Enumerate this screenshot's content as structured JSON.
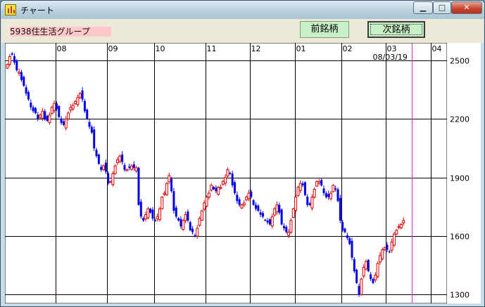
{
  "window": {
    "title": "チャート",
    "app_icon": "chart-app-icon",
    "controls": {
      "minimize": "minimize-icon",
      "maximize": "maximize-icon",
      "close": "close-icon"
    }
  },
  "toolbar": {
    "stock_label": "5938住生活グループ",
    "prev_button": "前銘柄",
    "next_button": "次銘柄"
  },
  "colors": {
    "up": "#e00000",
    "down": "#0000ee",
    "grid": "#000000",
    "marker": "#cc33cc",
    "label_bg": "#ffc8c8",
    "button_bg": "#c8f0c8"
  },
  "chart_data": {
    "type": "candlestick",
    "x_labels": [
      {
        "label": "08",
        "index": 21
      },
      {
        "label": "09",
        "index": 43
      },
      {
        "label": "10",
        "index": 63
      },
      {
        "label": "11",
        "index": 85
      },
      {
        "label": "12",
        "index": 104
      },
      {
        "label": "01",
        "index": 123
      },
      {
        "label": "02",
        "index": 143
      },
      {
        "label": "03",
        "index": 162
      },
      {
        "label": "04",
        "index": 181
      }
    ],
    "marker": {
      "label": "08/03/19",
      "index": 173
    },
    "y_ticks": [
      2500,
      2200,
      1900,
      1600,
      1300
    ],
    "ylim": [
      1255,
      2590
    ],
    "grid": true,
    "closes": [
      2480,
      2520,
      2530,
      2490,
      2450,
      2440,
      2400,
      2370,
      2330,
      2300,
      2260,
      2240,
      2230,
      2200,
      2220,
      2240,
      2200,
      2190,
      2220,
      2260,
      2280,
      2250,
      2210,
      2180,
      2170,
      2200,
      2230,
      2260,
      2270,
      2290,
      2310,
      2330,
      2300,
      2240,
      2200,
      2160,
      2130,
      2050,
      2010,
      1970,
      1940,
      1960,
      1930,
      1870,
      1880,
      1920,
      1960,
      1990,
      2010,
      1980,
      1940,
      1940,
      1950,
      1960,
      1950,
      1950,
      1760,
      1700,
      1680,
      1710,
      1740,
      1720,
      1690,
      1680,
      1700,
      1740,
      1800,
      1820,
      1870,
      1910,
      1830,
      1730,
      1700,
      1680,
      1650,
      1680,
      1710,
      1680,
      1630,
      1620,
      1600,
      1640,
      1690,
      1730,
      1770,
      1800,
      1820,
      1860,
      1840,
      1830,
      1850,
      1850,
      1880,
      1900,
      1940,
      1920,
      1860,
      1820,
      1780,
      1760,
      1760,
      1770,
      1800,
      1820,
      1800,
      1760,
      1740,
      1730,
      1710,
      1700,
      1680,
      1670,
      1660,
      1700,
      1740,
      1760,
      1720,
      1660,
      1640,
      1620,
      1620,
      1680,
      1740,
      1800,
      1850,
      1870,
      1860,
      1810,
      1760,
      1760,
      1800,
      1840,
      1880,
      1880,
      1860,
      1820,
      1800,
      1800,
      1820,
      1860,
      1840,
      1780,
      1680,
      1630,
      1620,
      1590,
      1560,
      1490,
      1420,
      1360,
      1300,
      1380,
      1440,
      1470,
      1420,
      1380,
      1360,
      1400,
      1460,
      1500,
      1530,
      1540,
      1530,
      1520,
      1570,
      1610,
      1630,
      1650,
      1660,
      1680
    ]
  }
}
